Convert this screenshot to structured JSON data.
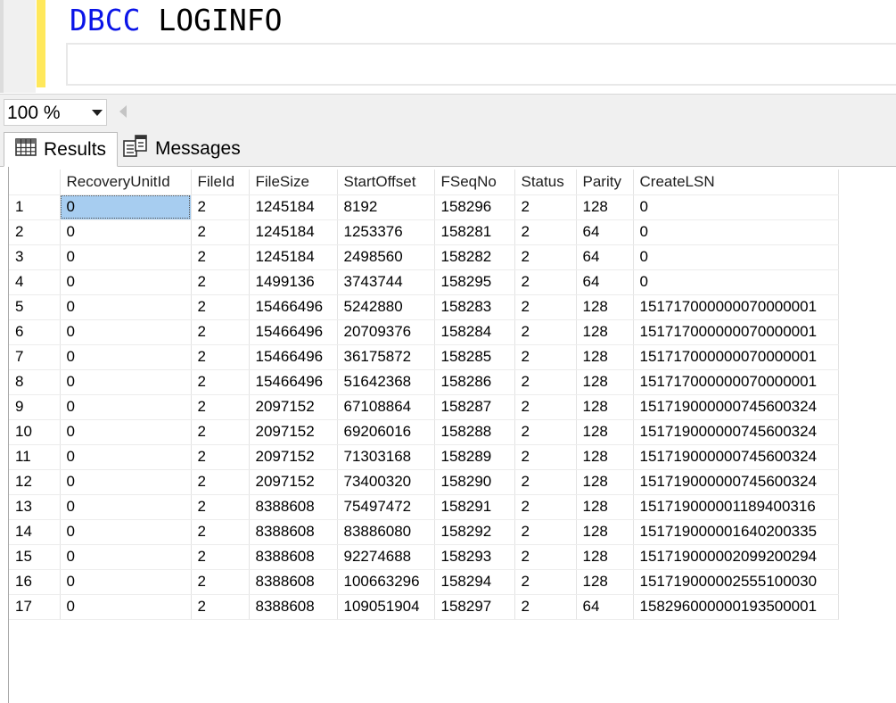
{
  "editor": {
    "keyword": "DBCC",
    "identifier": "LOGINFO"
  },
  "zoom": {
    "value": "100 %"
  },
  "tabs": {
    "results_label": "Results",
    "messages_label": "Messages"
  },
  "grid": {
    "columns": [
      "",
      "RecoveryUnitId",
      "FileId",
      "FileSize",
      "StartOffset",
      "FSeqNo",
      "Status",
      "Parity",
      "CreateLSN"
    ],
    "rows": [
      [
        "1",
        "0",
        "2",
        "1245184",
        "8192",
        "158296",
        "2",
        "128",
        "0"
      ],
      [
        "2",
        "0",
        "2",
        "1245184",
        "1253376",
        "158281",
        "2",
        "64",
        "0"
      ],
      [
        "3",
        "0",
        "2",
        "1245184",
        "2498560",
        "158282",
        "2",
        "64",
        "0"
      ],
      [
        "4",
        "0",
        "2",
        "1499136",
        "3743744",
        "158295",
        "2",
        "64",
        "0"
      ],
      [
        "5",
        "0",
        "2",
        "15466496",
        "5242880",
        "158283",
        "2",
        "128",
        "151717000000070000001"
      ],
      [
        "6",
        "0",
        "2",
        "15466496",
        "20709376",
        "158284",
        "2",
        "128",
        "151717000000070000001"
      ],
      [
        "7",
        "0",
        "2",
        "15466496",
        "36175872",
        "158285",
        "2",
        "128",
        "151717000000070000001"
      ],
      [
        "8",
        "0",
        "2",
        "15466496",
        "51642368",
        "158286",
        "2",
        "128",
        "151717000000070000001"
      ],
      [
        "9",
        "0",
        "2",
        "2097152",
        "67108864",
        "158287",
        "2",
        "128",
        "151719000000745600324"
      ],
      [
        "10",
        "0",
        "2",
        "2097152",
        "69206016",
        "158288",
        "2",
        "128",
        "151719000000745600324"
      ],
      [
        "11",
        "0",
        "2",
        "2097152",
        "71303168",
        "158289",
        "2",
        "128",
        "151719000000745600324"
      ],
      [
        "12",
        "0",
        "2",
        "2097152",
        "73400320",
        "158290",
        "2",
        "128",
        "151719000000745600324"
      ],
      [
        "13",
        "0",
        "2",
        "8388608",
        "75497472",
        "158291",
        "2",
        "128",
        "151719000001189400316"
      ],
      [
        "14",
        "0",
        "2",
        "8388608",
        "83886080",
        "158292",
        "2",
        "128",
        "151719000001640200335"
      ],
      [
        "15",
        "0",
        "2",
        "8388608",
        "92274688",
        "158293",
        "2",
        "128",
        "151719000002099200294"
      ],
      [
        "16",
        "0",
        "2",
        "8388608",
        "100663296",
        "158294",
        "2",
        "128",
        "151719000002555100030"
      ],
      [
        "17",
        "0",
        "2",
        "8388608",
        "109051904",
        "158297",
        "2",
        "64",
        "158296000000193500001"
      ]
    ]
  }
}
